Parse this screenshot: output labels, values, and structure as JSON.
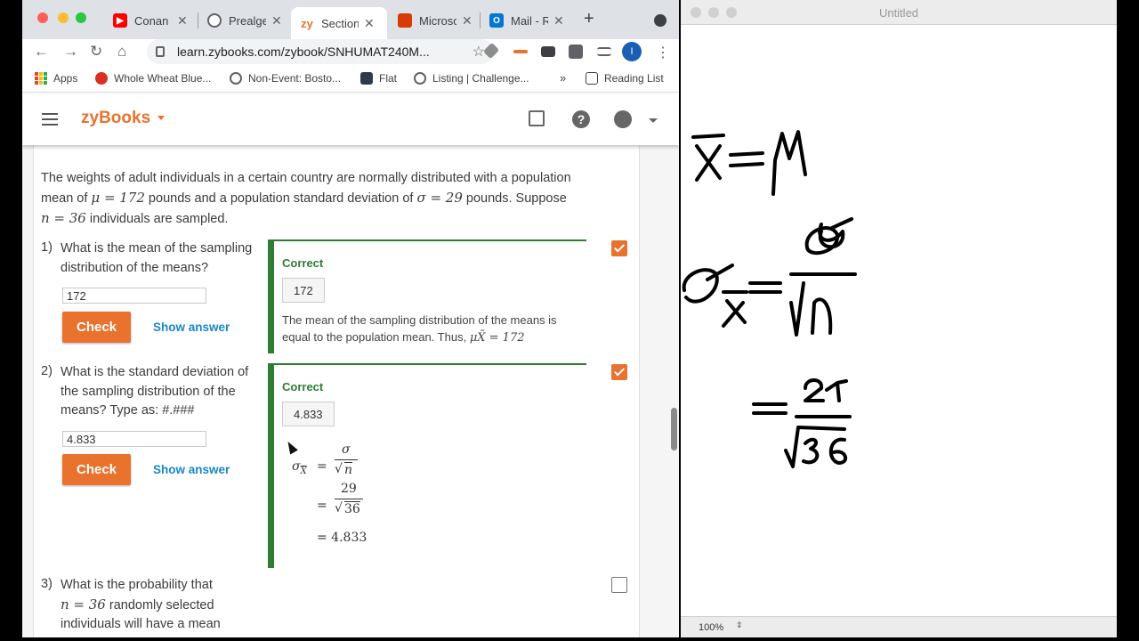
{
  "tabs": [
    {
      "label": "Conan The...",
      "icon": "youtube-icon",
      "color": "#ff0000"
    },
    {
      "label": "Prealgebra",
      "icon": "globe-icon",
      "color": "#5f6368"
    },
    {
      "label": "Section",
      "icon": "zybooks-icon",
      "color": "#e8722e",
      "active": true
    },
    {
      "label": "Microsoft",
      "icon": "office-icon",
      "color": "#d83b01"
    },
    {
      "label": "Mail - R",
      "icon": "outlook-icon",
      "color": "#0078d4"
    }
  ],
  "url": "learn.zybooks.com/zybook/SNHUMAT240M...",
  "profile_initial": "I",
  "bookmarks": [
    {
      "label": "Apps"
    },
    {
      "label": "Whole Wheat Blue..."
    },
    {
      "label": "Non-Event: Bosto..."
    },
    {
      "label": "Flat"
    },
    {
      "label": "Listing | Challenge..."
    },
    {
      "label": "Reading List"
    }
  ],
  "bookmarks_more": "»",
  "brand": "zyBooks",
  "prompt": {
    "part1": "The weights of adult individuals in a certain country are normally distributed with a population mean of ",
    "mu": "μ = 172",
    "part2": " pounds and a population standard deviation of ",
    "sigma": "σ = 29",
    "part3": " pounds. Suppose ",
    "n": "n = 36",
    "part4": " individuals are sampled."
  },
  "questions": [
    {
      "number": "1)",
      "text": "What is the mean of the sampling distribution of the means?",
      "input_value": "172",
      "check_label": "Check",
      "show_answer_label": "Show answer",
      "feedback_title": "Correct",
      "answer": "172",
      "explanation": "The mean of the sampling distribution of the means is equal to the population mean. Thus, ",
      "explanation_math": "μX̄ = 172",
      "checked": true
    },
    {
      "number": "2)",
      "text": "What is the standard deviation of the sampling distribution of the means? Type as: #.###",
      "input_value": "4.833",
      "check_label": "Check",
      "show_answer_label": "Show answer",
      "feedback_title": "Correct",
      "answer": "4.833",
      "calc": {
        "lhs": "σ",
        "lhs_sub": "X",
        "sym_sigma": "σ",
        "sym_n": "n",
        "numerator": "29",
        "radicand": "36",
        "eq": "=",
        "result": "= 4.833"
      },
      "checked": true
    },
    {
      "number": "3)",
      "text_a": "What is the probability that",
      "text_n": "n = 36",
      "text_b": " randomly selected individuals will have a mean",
      "checked": false
    }
  ],
  "drawing": {
    "title": "Untitled",
    "zoom": "100%",
    "ink_color": "#000000"
  },
  "colors": {
    "accent": "#e8722e",
    "correct": "#2e7d32",
    "link": "#1a87c8"
  }
}
